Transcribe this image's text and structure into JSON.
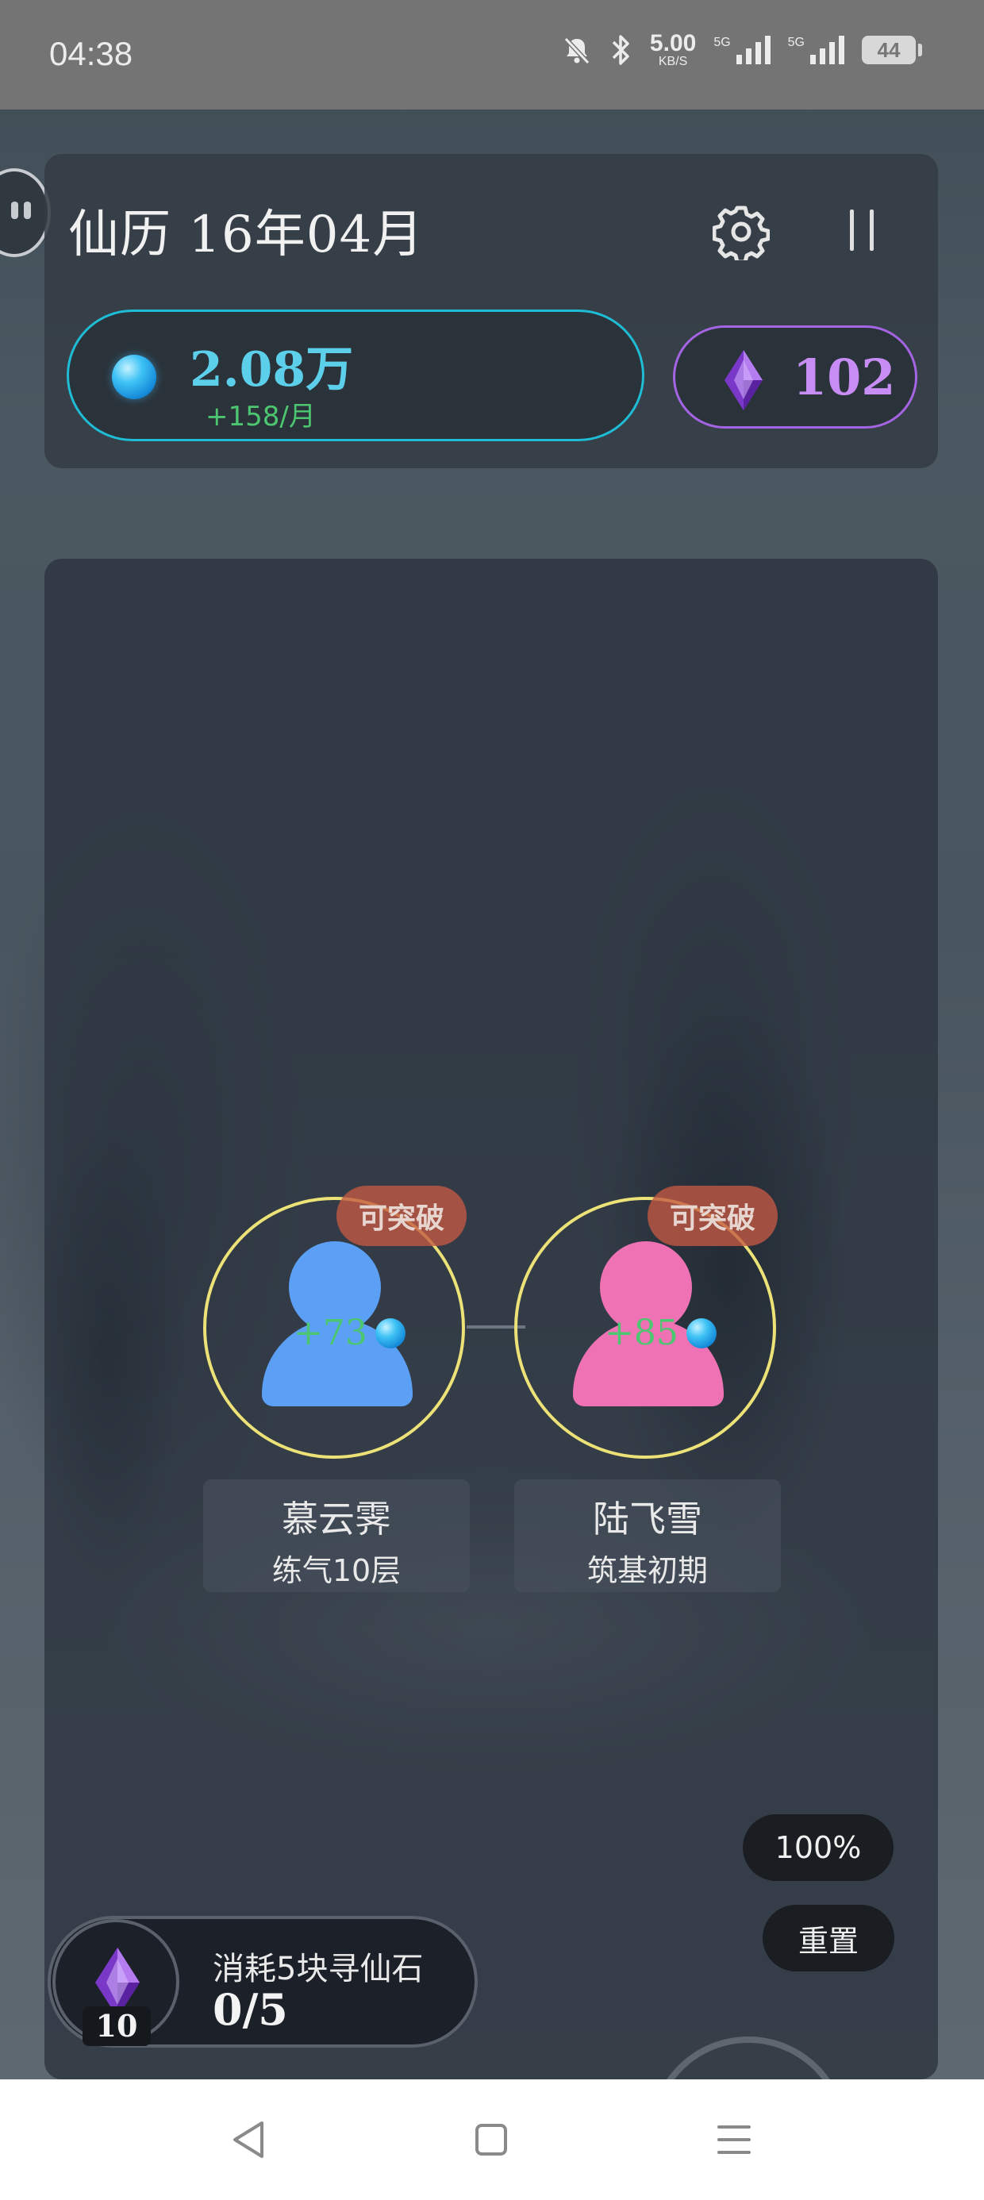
{
  "status_bar": {
    "time": "04:38",
    "net_speed_value": "5.00",
    "net_speed_unit": "KB/S",
    "signal_1_label": "5G",
    "signal_2_label": "5G",
    "battery": "44"
  },
  "header": {
    "calendar": "仙历 16年04月"
  },
  "resources": {
    "spirit_stones": "2.08万",
    "spirit_rate": "+158/月",
    "crystals": "102"
  },
  "disciples": [
    {
      "name": "慕云霁",
      "realm": "练气10层",
      "gain": "+73",
      "badge": "可突破",
      "color": "#5ca0f5"
    },
    {
      "name": "陆飞雪",
      "realm": "筑基初期",
      "gain": "+85",
      "badge": "可突破",
      "color": "#ee72b4"
    }
  ],
  "controls": {
    "zoom": "100%",
    "reset": "重置"
  },
  "seek": {
    "label": "消耗5块寻仙石",
    "progress": "0/5",
    "count": "10"
  },
  "colors": {
    "accent_cyan": "#1fbcd6",
    "accent_purple": "#a464e4",
    "ring_yellow": "#ece277",
    "gain_green": "#4cc670"
  }
}
